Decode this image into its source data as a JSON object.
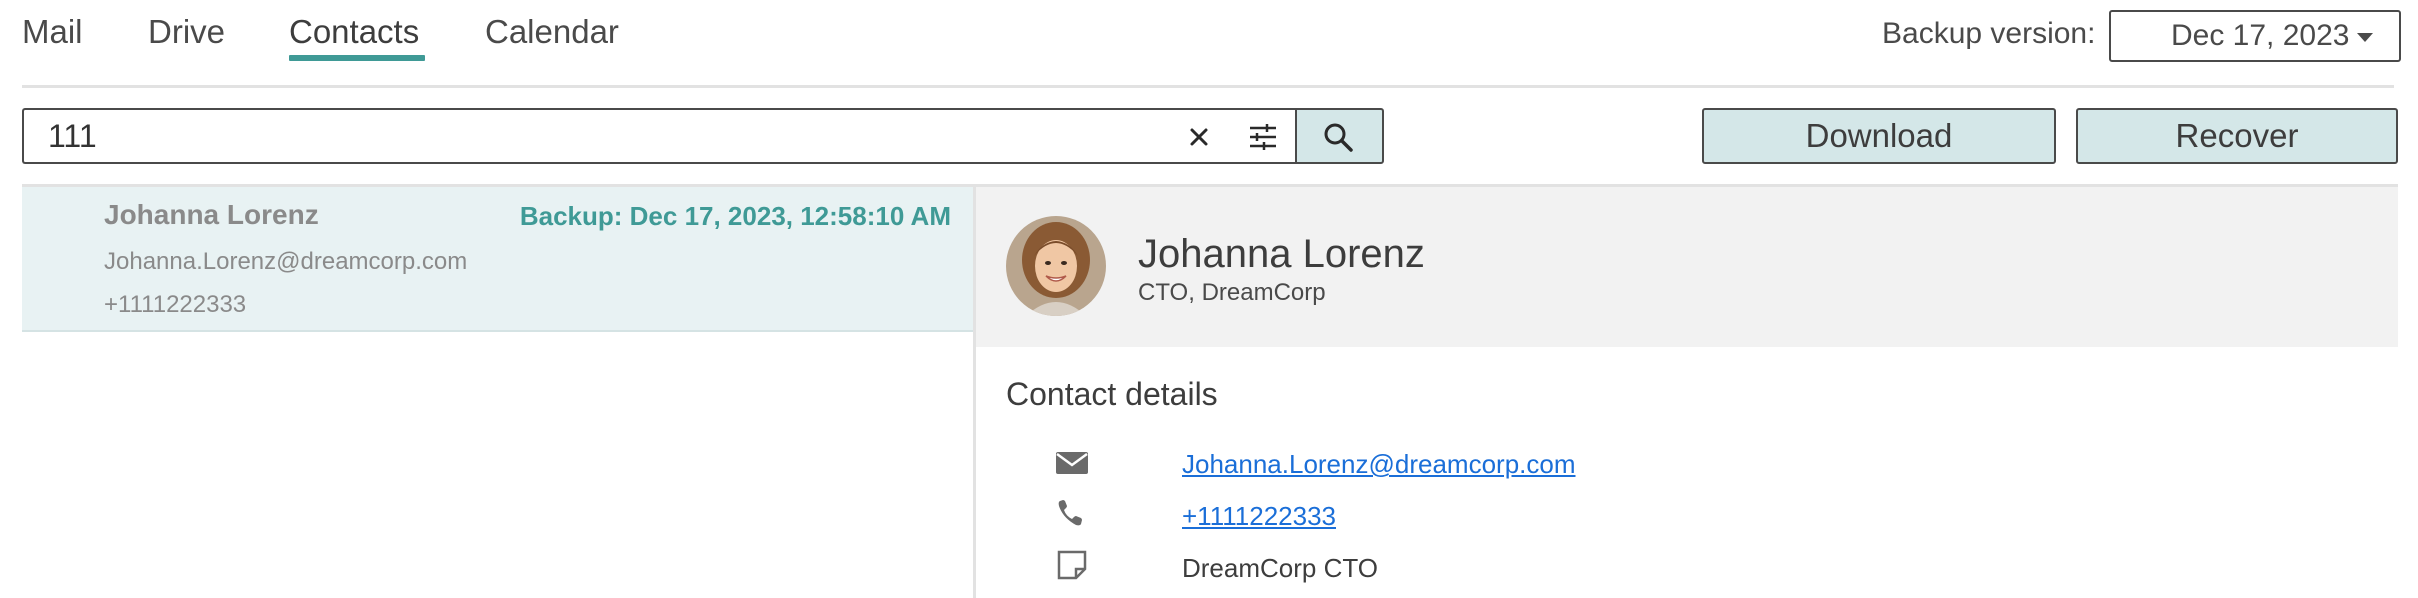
{
  "nav": {
    "tabs": [
      {
        "label": "Mail"
      },
      {
        "label": "Drive"
      },
      {
        "label": "Contacts"
      },
      {
        "label": "Calendar"
      }
    ],
    "active_tab": "Contacts",
    "accent_color": "#3f9a96"
  },
  "backup": {
    "label": "Backup version:",
    "selected": "Dec 17, 2023"
  },
  "search": {
    "value": "111"
  },
  "toolbar": {
    "download_label": "Download",
    "recover_label": "Recover"
  },
  "list": {
    "items": [
      {
        "name": "Johanna Lorenz",
        "email": "Johanna.Lorenz@dreamcorp.com",
        "phone": "+1111222333",
        "backup": "Backup: Dec 17, 2023, 12:58:10 AM"
      }
    ]
  },
  "detail": {
    "name": "Johanna Lorenz",
    "title": "CTO, DreamCorp",
    "section_heading": "Contact details",
    "email": "Johanna.Lorenz@dreamcorp.com",
    "phone": "+1111222333",
    "note": "DreamCorp CTO"
  },
  "icons": {
    "clear": "close-icon",
    "filter": "sliders-icon",
    "search": "search-icon",
    "email": "envelope-icon",
    "phone": "phone-icon",
    "note": "note-icon"
  }
}
